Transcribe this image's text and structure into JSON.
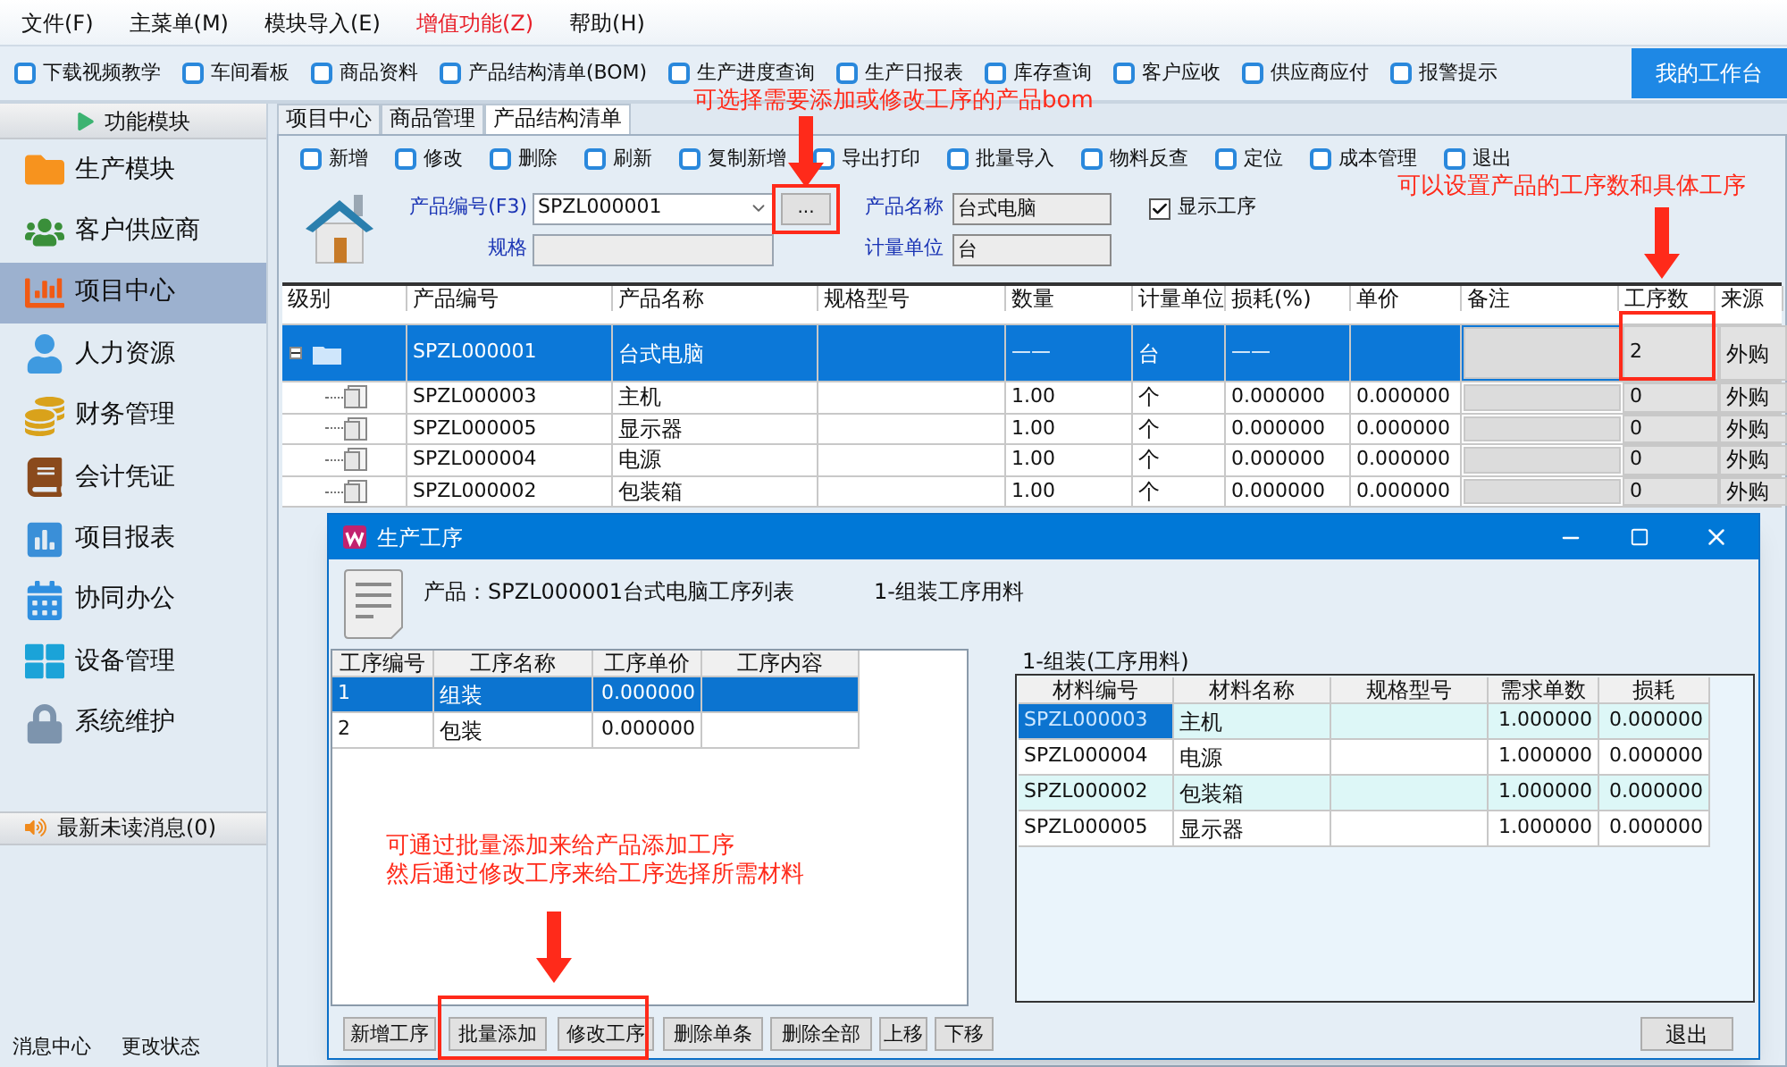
{
  "menu": [
    {
      "label": "文件(F)",
      "highlighted": false
    },
    {
      "label": "主菜单(M)",
      "highlighted": false
    },
    {
      "label": "模块导入(E)",
      "highlighted": false
    },
    {
      "label": "增值功能(Z)",
      "highlighted": true
    },
    {
      "label": "帮助(H)",
      "highlighted": false
    }
  ],
  "quick_toolbar": {
    "items": [
      "下载视频教学",
      "车间看板",
      "商品资料",
      "产品结构清单(BOM)",
      "生产进度查询",
      "生产日报表",
      "库存查询",
      "客户应收",
      "供应商应付",
      "报警提示"
    ],
    "workbench_button": "我的工作台"
  },
  "sidebar": {
    "header": "功能模块",
    "items": [
      {
        "label": "生产模块",
        "selected": false
      },
      {
        "label": "客户供应商",
        "selected": false
      },
      {
        "label": "项目中心",
        "selected": true
      },
      {
        "label": "人力资源",
        "selected": false
      },
      {
        "label": "财务管理",
        "selected": false
      },
      {
        "label": "会计凭证",
        "selected": false
      },
      {
        "label": "项目报表",
        "selected": false
      },
      {
        "label": "协同办公",
        "selected": false
      },
      {
        "label": "设备管理",
        "selected": false
      },
      {
        "label": "系统维护",
        "selected": false
      }
    ],
    "messages_header": "最新未读消息(0)",
    "footer": [
      "消息中心",
      "更改状态"
    ]
  },
  "tabs": [
    {
      "label": "项目中心",
      "selected": false
    },
    {
      "label": "商品管理",
      "selected": false
    },
    {
      "label": "产品结构清单",
      "selected": true
    }
  ],
  "toolbar": [
    "新增",
    "修改",
    "删除",
    "刷新",
    "复制新增",
    "导出打印",
    "批量导入",
    "物料反查",
    "定位",
    "成本管理",
    "退出"
  ],
  "form": {
    "code_label": "产品编号(F3)",
    "code_value": "SPZL000001",
    "browse_button": "...",
    "spec_label": "规格",
    "name_label": "产品名称",
    "name_value": "台式电脑",
    "unit_label": "计量单位",
    "unit_value": "台",
    "show_process": {
      "label": "显示工序",
      "checked": true
    }
  },
  "table": {
    "columns": [
      "级别",
      "产品编号",
      "产品名称",
      "规格型号",
      "数量",
      "计量单位",
      "损耗(%)",
      "单价",
      "备注",
      "工序数",
      "来源"
    ],
    "rows": [
      {
        "kind": "parent",
        "selected": true,
        "code": "SPZL000001",
        "name": "台式电脑",
        "qty": "——",
        "unit": "台",
        "loss": "——",
        "process_count": "2",
        "source": "外购"
      },
      {
        "kind": "child",
        "selected": false,
        "code": "SPZL000003",
        "name": "主机",
        "qty": "1.00",
        "unit": "个",
        "loss": "0.000000",
        "price": "0.000000",
        "process_count": "0",
        "source": "外购"
      },
      {
        "kind": "child",
        "selected": false,
        "code": "SPZL000005",
        "name": "显示器",
        "qty": "1.00",
        "unit": "个",
        "loss": "0.000000",
        "price": "0.000000",
        "process_count": "0",
        "source": "外购"
      },
      {
        "kind": "child",
        "selected": false,
        "code": "SPZL000004",
        "name": "电源",
        "qty": "1.00",
        "unit": "个",
        "loss": "0.000000",
        "price": "0.000000",
        "process_count": "0",
        "source": "外购"
      },
      {
        "kind": "child",
        "selected": false,
        "code": "SPZL000002",
        "name": "包装箱",
        "qty": "1.00",
        "unit": "个",
        "loss": "0.000000",
        "price": "0.000000",
        "process_count": "0",
        "source": "外购"
      }
    ]
  },
  "dialog": {
    "title": "生产工序",
    "product_caption": "产品：SPZL000001台式电脑工序列表",
    "material_caption": "1-组装工序用料",
    "process_table": {
      "columns": [
        "工序编号",
        "工序名称",
        "工序单价",
        "工序内容"
      ],
      "rows": [
        {
          "no": "1",
          "name": "组装",
          "price": "0.000000",
          "selected": true
        },
        {
          "no": "2",
          "name": "包装",
          "price": "0.000000",
          "selected": false
        }
      ]
    },
    "material_group": "1-组装(工序用料)",
    "material_table": {
      "columns": [
        "材料编号",
        "材料名称",
        "规格型号",
        "需求单数",
        "损耗"
      ],
      "rows": [
        {
          "code": "SPZL000003",
          "name": "主机",
          "qty": "1.000000",
          "loss": "0.000000",
          "selected": true
        },
        {
          "code": "SPZL000004",
          "name": "电源",
          "qty": "1.000000",
          "loss": "0.000000",
          "selected": false
        },
        {
          "code": "SPZL000002",
          "name": "包装箱",
          "qty": "1.000000",
          "loss": "0.000000",
          "selected": false
        },
        {
          "code": "SPZL000005",
          "name": "显示器",
          "qty": "1.000000",
          "loss": "0.000000",
          "selected": false
        }
      ]
    },
    "buttons": [
      "新增工序",
      "批量添加",
      "修改工序",
      "删除单条",
      "删除全部",
      "上移",
      "下移"
    ],
    "exit_button": "退出"
  },
  "annotations": [
    {
      "lines": [
        "可选择需要添加或修改工序的产品bom"
      ]
    },
    {
      "lines": [
        "可以设置产品的工序数和具体工序"
      ]
    },
    {
      "lines": [
        "可通过批量添加来给产品添加工序",
        "然后通过修改工序来给工序选择所需材料"
      ]
    }
  ]
}
